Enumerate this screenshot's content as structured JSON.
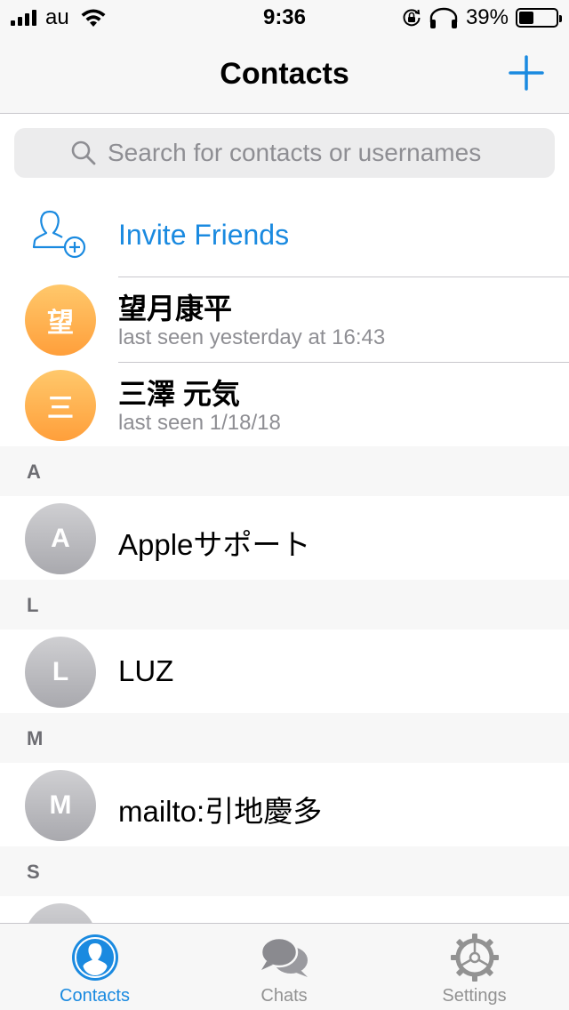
{
  "status_bar": {
    "carrier": "au",
    "time": "9:36",
    "battery_percent": "39%",
    "battery_level": 0.39,
    "icons": [
      "signal-icon",
      "wifi-icon",
      "rotation-lock-icon",
      "headphones-icon",
      "battery-icon"
    ]
  },
  "nav": {
    "title": "Contacts",
    "add_icon": "plus-icon"
  },
  "search": {
    "placeholder": "Search for contacts or usernames"
  },
  "invite": {
    "label": "Invite Friends",
    "icon": "add-contact-icon"
  },
  "recent_contacts": [
    {
      "initial": "望",
      "name": "望月康平",
      "status": "last seen yesterday at 16:43"
    },
    {
      "initial": "三",
      "name": "三澤 元気",
      "status": "last seen 1/18/18"
    }
  ],
  "sections": [
    {
      "letter": "A",
      "contacts": [
        {
          "initial": "A",
          "name": "Appleサポート"
        }
      ]
    },
    {
      "letter": "L",
      "contacts": [
        {
          "initial": "L",
          "name": "LUZ"
        }
      ]
    },
    {
      "letter": "M",
      "contacts": [
        {
          "initial": "M",
          "name": "mailto:引地慶多"
        }
      ]
    },
    {
      "letter": "S",
      "contacts": []
    }
  ],
  "tabs": [
    {
      "label": "Contacts",
      "icon": "person-icon",
      "active": true
    },
    {
      "label": "Chats",
      "icon": "chat-bubbles-icon",
      "active": false
    },
    {
      "label": "Settings",
      "icon": "gear-icon",
      "active": false
    }
  ],
  "colors": {
    "accent": "#1a8ae0",
    "avatar_orange": "#ffb04f",
    "avatar_gray": "#b8b8bd",
    "secondary_text": "#8e8e93",
    "section_bg": "#f7f7f7"
  }
}
